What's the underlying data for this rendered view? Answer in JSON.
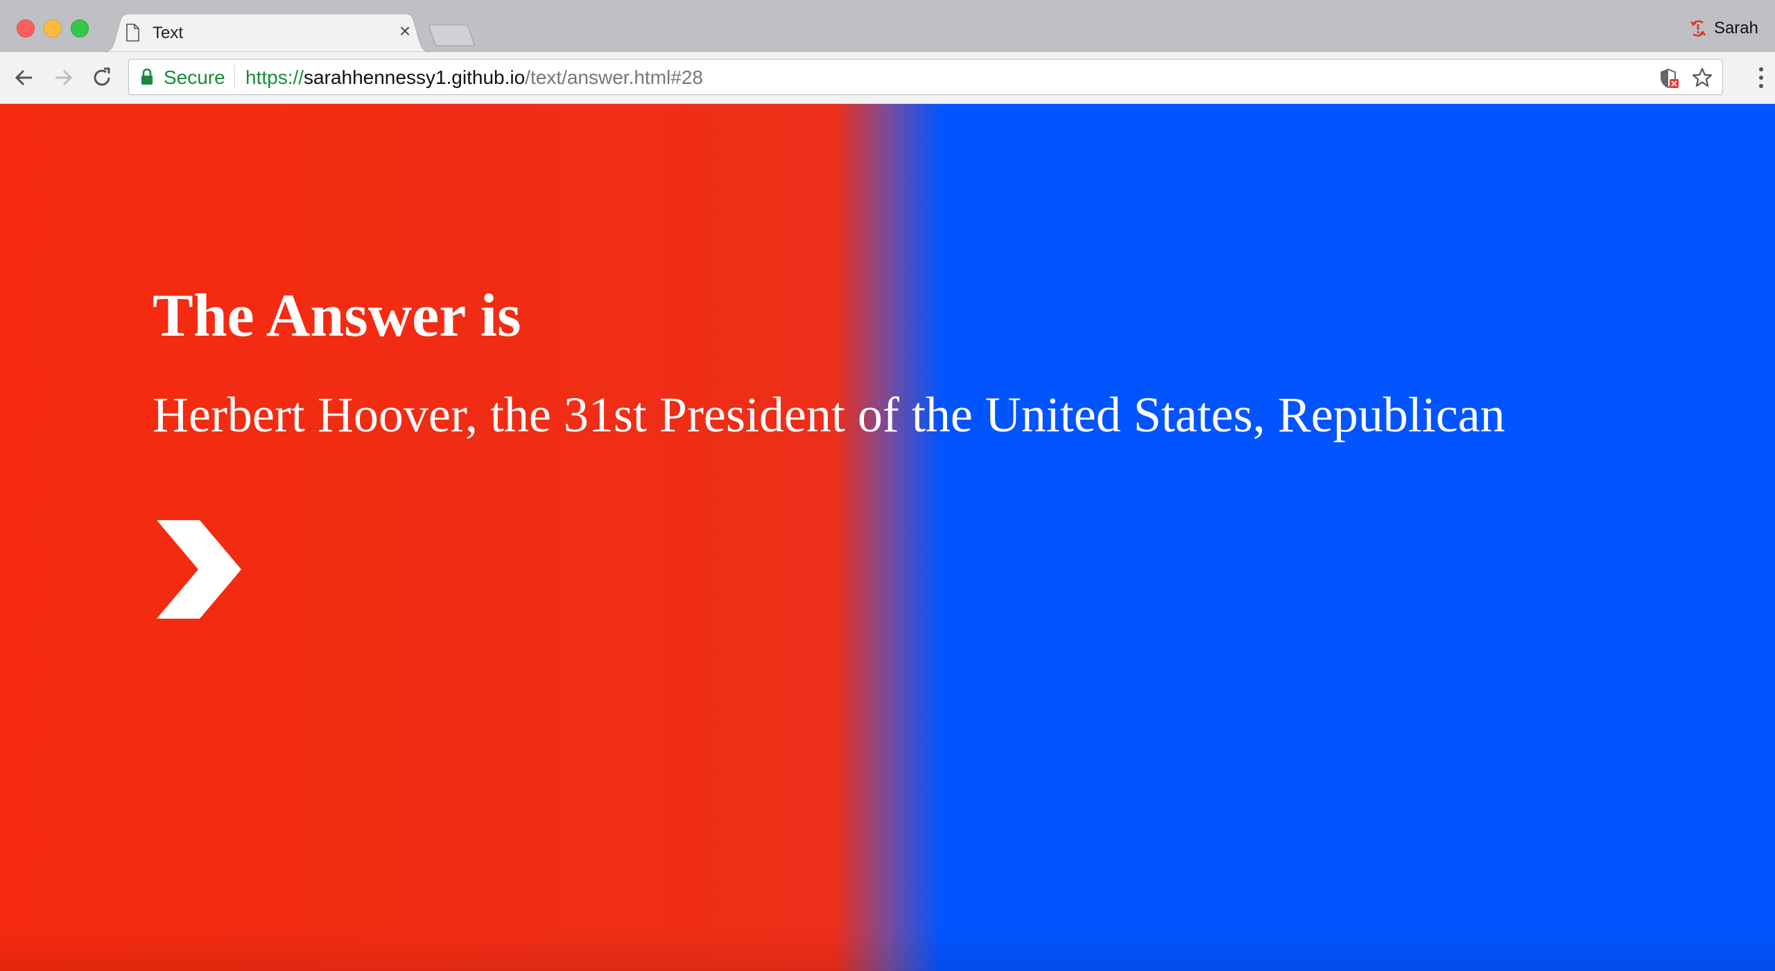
{
  "browser": {
    "tab": {
      "title": "Text",
      "close_glyph": "×",
      "icon": "document-icon"
    },
    "profile": {
      "name": "Sarah",
      "icon": "sync-error-icon",
      "accent_color": "#e0382f"
    },
    "omnibox": {
      "secure_label": "Secure",
      "url_scheme": "https://",
      "url_host": "sarahhennessy1.github.io",
      "url_path": "/text/answer.html#28",
      "secure_color": "#1a8b3a"
    }
  },
  "page": {
    "heading": "The Answer is",
    "answer": "Herbert Hoover, the 31st President of the United States, Republican",
    "next_icon": "chevron-right-icon",
    "colors": {
      "left": "#f52a0f",
      "right": "#0254ff",
      "text": "#ffffff"
    }
  }
}
